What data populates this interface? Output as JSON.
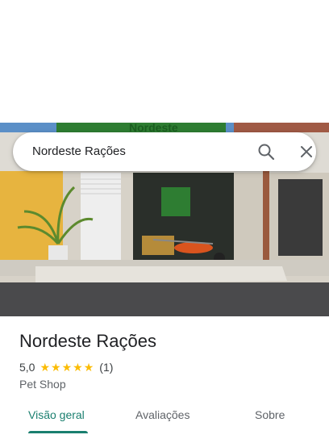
{
  "search": {
    "query": "Nordeste Rações"
  },
  "place": {
    "title": "Nordeste Rações",
    "rating": "5,0",
    "stars": 5,
    "review_count": "(1)",
    "category": "Pet Shop"
  },
  "photo": {
    "sign_text": "Nordeste"
  },
  "tabs": [
    {
      "label": "Visão geral",
      "active": true
    },
    {
      "label": "Avaliações",
      "active": false
    },
    {
      "label": "Sobre",
      "active": false
    }
  ],
  "colors": {
    "accent": "#1a7f6f",
    "star": "#fbbc04"
  }
}
